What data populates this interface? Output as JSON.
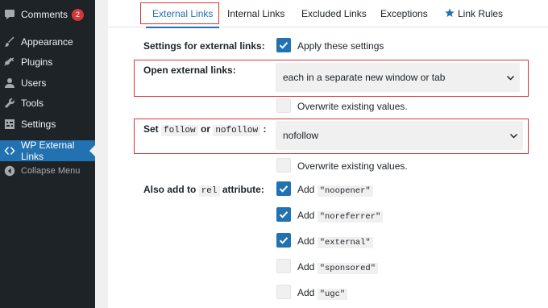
{
  "sidebar": {
    "comments_label": "Comments",
    "comments_badge": "2",
    "appearance_label": "Appearance",
    "plugins_label": "Plugins",
    "users_label": "Users",
    "tools_label": "Tools",
    "settings_label": "Settings",
    "wpel_label": "WP External Links",
    "collapse_label": "Collapse Menu"
  },
  "tabs": {
    "external": "External Links",
    "internal": "Internal Links",
    "excluded": "Excluded Links",
    "exceptions": "Exceptions",
    "link_rules": "Link Rules"
  },
  "form": {
    "settings_label": "Settings for external links:",
    "apply_label": "Apply these settings",
    "apply_checked": true,
    "open_label": "Open external links:",
    "open_value": "each in a separate new window or tab",
    "overwrite1_label": "Overwrite existing values.",
    "overwrite1_checked": false,
    "set_word": "Set",
    "follow_code": "follow",
    "or_word": "or",
    "nofollow_code": "nofollow",
    "colon": ":",
    "follow_value": "nofollow",
    "overwrite2_label": "Overwrite existing values.",
    "overwrite2_checked": false,
    "also_add_word": "Also add to",
    "rel_code": "rel",
    "attribute_word": "attribute:",
    "add_word": "Add",
    "rel_options": [
      {
        "value": "\"noopener\"",
        "checked": true
      },
      {
        "value": "\"noreferrer\"",
        "checked": true
      },
      {
        "value": "\"external\"",
        "checked": true
      },
      {
        "value": "\"sponsored\"",
        "checked": false
      },
      {
        "value": "\"ugc\"",
        "checked": false
      }
    ]
  },
  "colors": {
    "accent": "#2271b1",
    "highlight": "#d63638",
    "sidebar_bg": "#1d2327"
  }
}
